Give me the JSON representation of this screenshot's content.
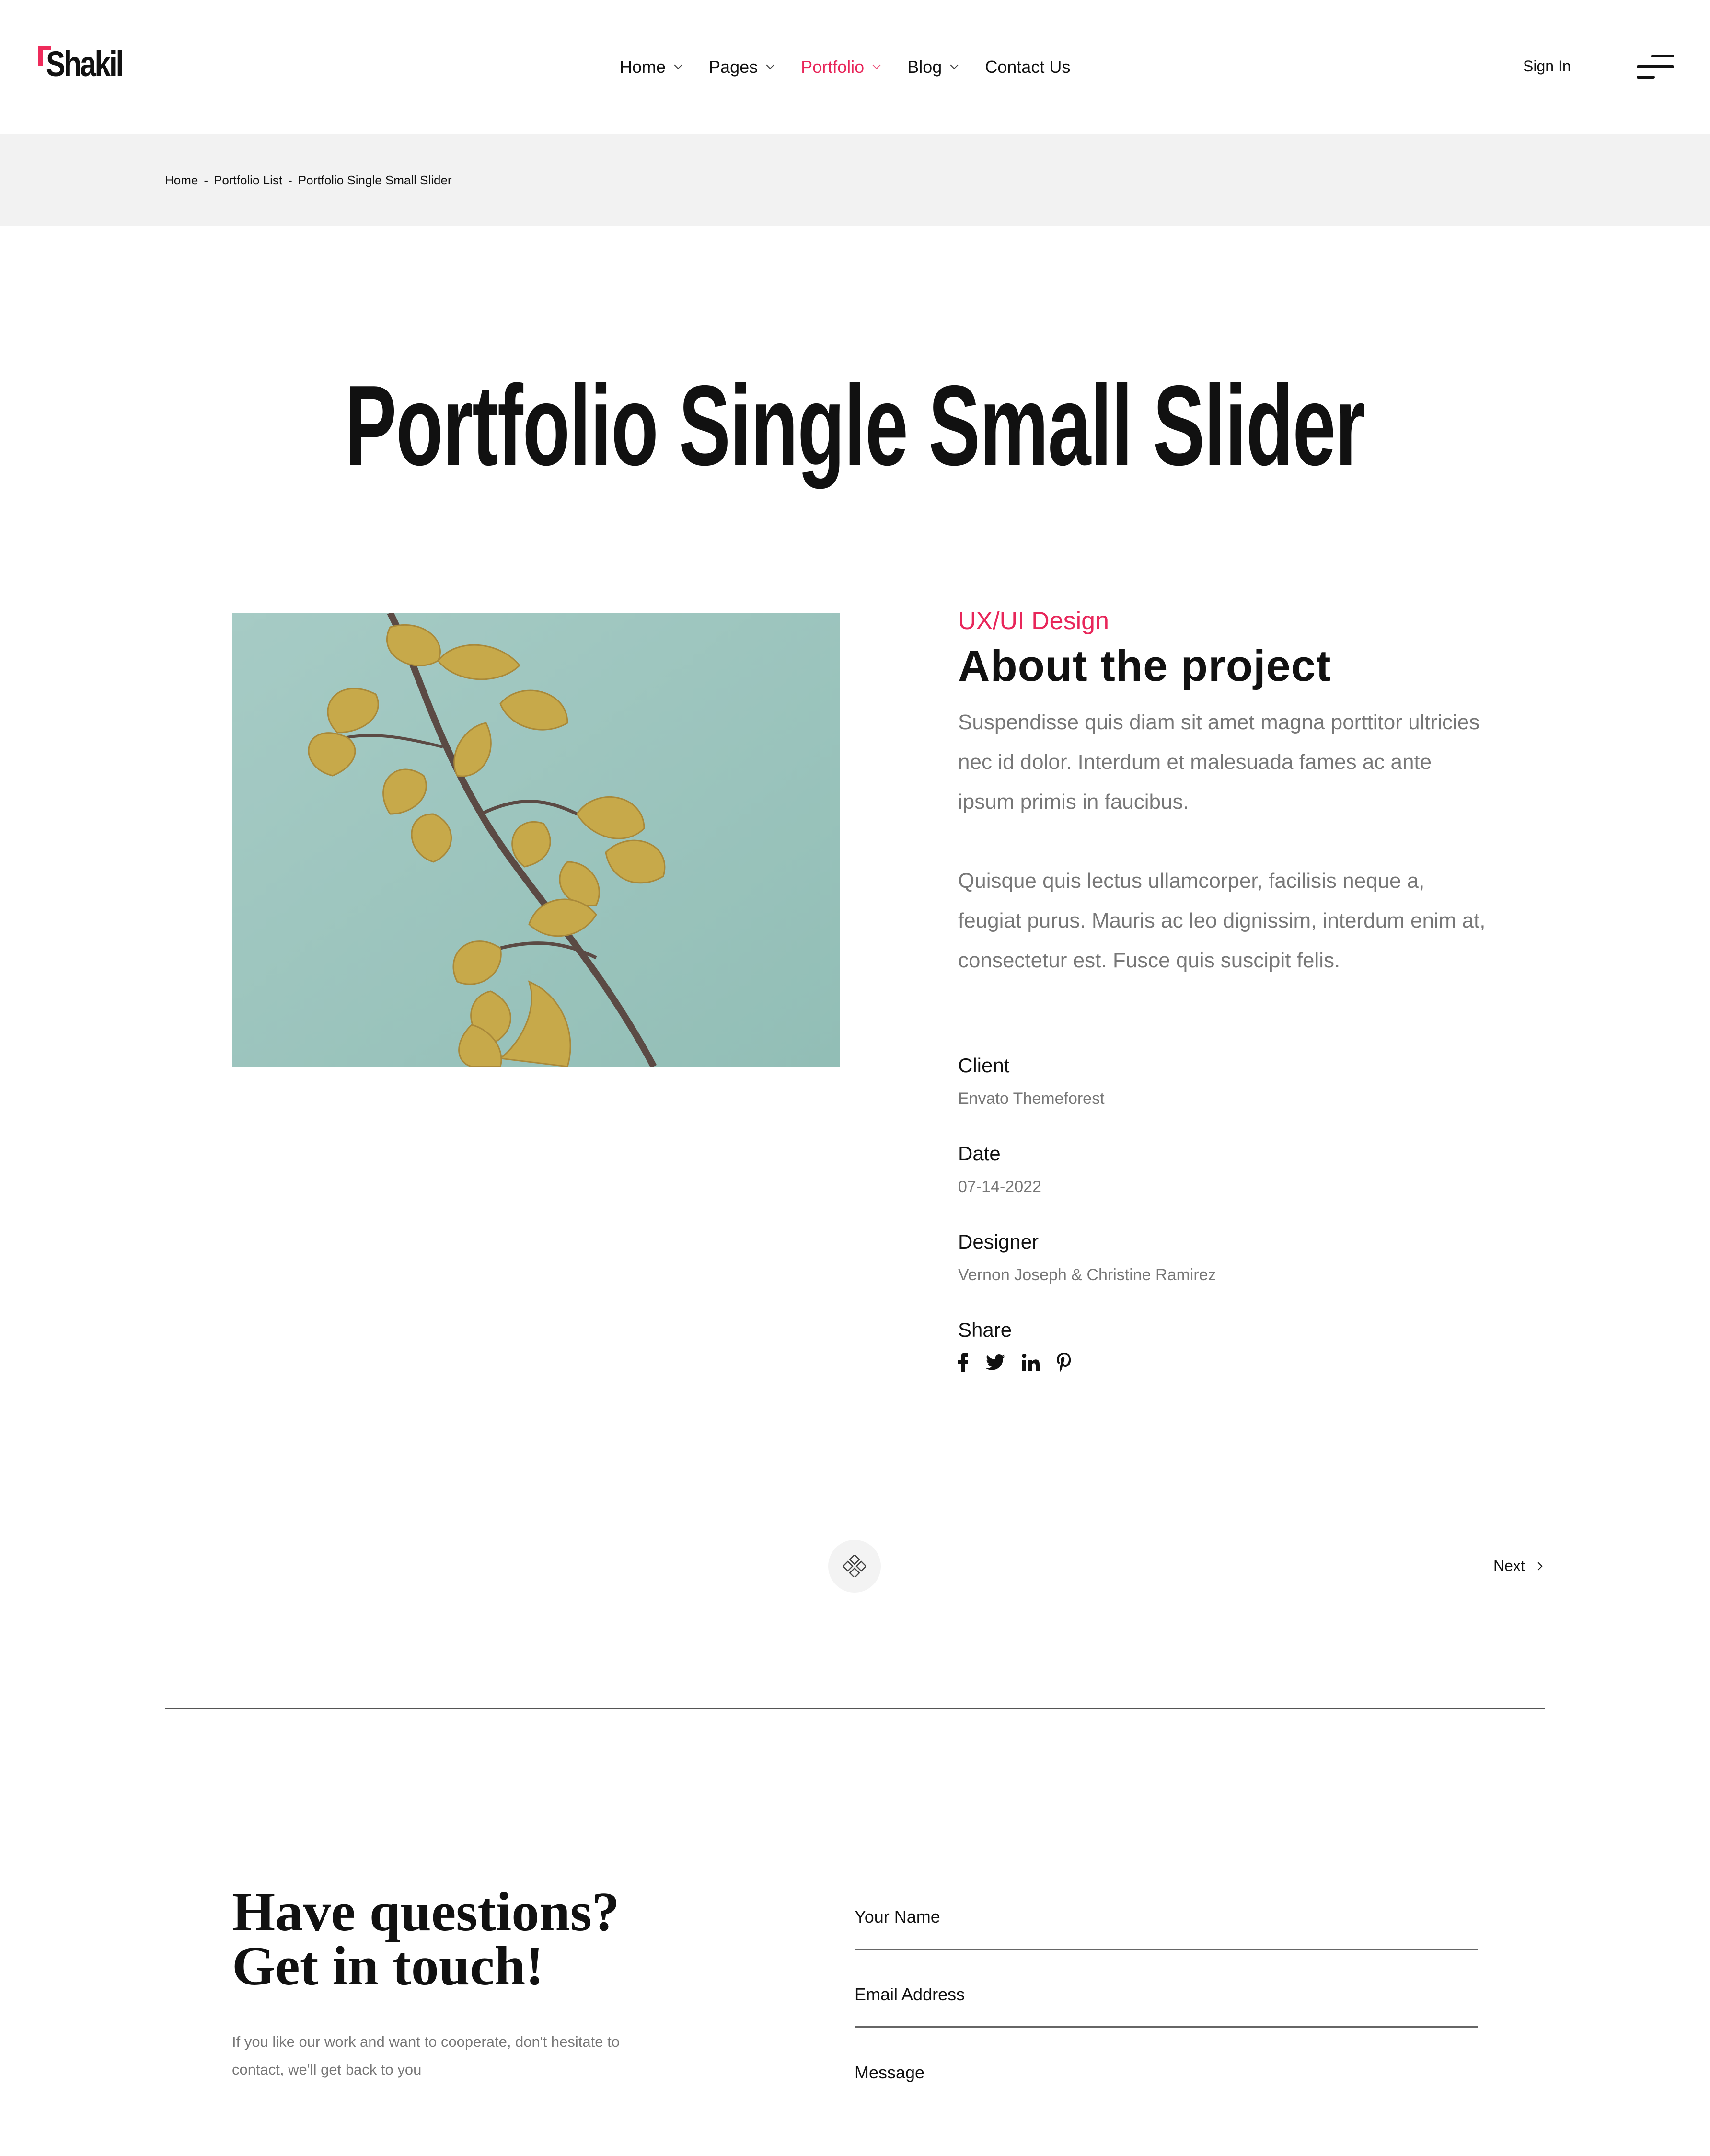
{
  "header": {
    "logo_text": "Shakil",
    "nav": [
      {
        "label": "Home"
      },
      {
        "label": "Pages"
      },
      {
        "label": "Portfolio"
      },
      {
        "label": "Blog"
      },
      {
        "label": "Contact Us"
      }
    ],
    "signin_label": "Sign In"
  },
  "breadcrumb": {
    "items": [
      "Home",
      "Portfolio List",
      "Portfolio Single Small Slider"
    ],
    "separator": "-"
  },
  "page_title": "Portfolio Single Small Slider",
  "project": {
    "category": "UX/UI Design",
    "title": "About the project",
    "paragraphs": [
      "Suspendisse quis diam sit amet magna porttitor ultricies nec id dolor. Interdum et malesuada fames ac ante ipsum primis in faucibus.",
      "Quisque quis lectus ullamcorper, facilisis neque a, feugiat purus. Mauris ac leo dignissim, interdum enim at, consectetur est. Fusce quis suscipit felis."
    ],
    "meta": [
      {
        "label": "Client",
        "value": "Envato Themeforest"
      },
      {
        "label": "Date",
        "value": "07-14-2022"
      },
      {
        "label": "Designer",
        "value": "Vernon Joseph & Christine Ramirez"
      }
    ],
    "share_label": "Share",
    "share_icons": [
      "facebook-icon",
      "twitter-icon",
      "linkedin-icon",
      "pinterest-icon"
    ]
  },
  "pager": {
    "grid_icon": "grid-icon",
    "next_label": "Next"
  },
  "contact": {
    "title_line1": "Have questions?",
    "title_line2": "Get in touch!",
    "text": "If you like our work and want to cooperate, don't hesitate to contact, we'll get back to you",
    "fields": [
      "Your Name",
      "Email Address",
      "Message"
    ]
  },
  "colors": {
    "accent": "#e8265a",
    "text": "#111111",
    "muted": "#777777",
    "breadcrumb_bg": "#f2f2f2",
    "image_sky": "#9bc4bd",
    "leaf": "#c7a94a"
  }
}
